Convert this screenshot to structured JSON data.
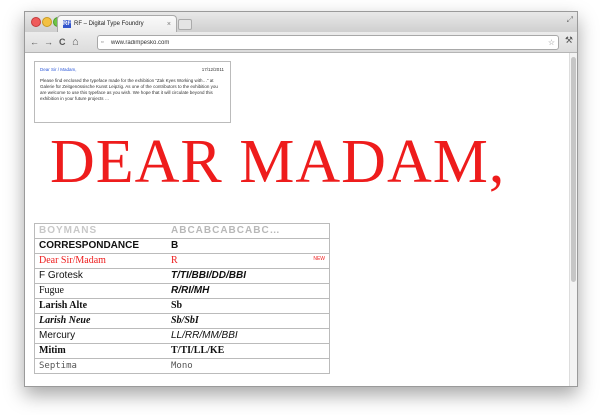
{
  "browser": {
    "tab_title": "RF – Digital Type Foundry",
    "tab_favicon": "RF",
    "url": "www.radimpesko.com",
    "close_glyph": "×",
    "back_glyph": "←",
    "forward_glyph": "→",
    "reload_glyph": "C",
    "home_glyph": "⌂",
    "star_glyph": "☆",
    "wrench_glyph": "⚒",
    "resize_glyph": "⤢"
  },
  "letter": {
    "greeting": "Dear Sir / Madam,",
    "date": "17/12/2011",
    "body": "Please find enclosed the typeface made for the exhibition “Zak Kyes Working with…” at Galerie für Zeitgenössische Kunst Leipzig. As one of the contributors to the exhibition you are welcome to use this typeface as you wish. We hope that it will circulate beyond this exhibition in your future projects …"
  },
  "headline": "DEAR MADAM,",
  "fonts": [
    {
      "name": "BOYMANS",
      "sample": "ABCABCABCABC…",
      "badge": ""
    },
    {
      "name": "CORRESPONDANCE",
      "sample": "B",
      "badge": ""
    },
    {
      "name": "Dear Sir/Madam",
      "sample": "R",
      "badge": "NEW"
    },
    {
      "name": "F Grotesk",
      "sample": "T/TI/BBI/DD/BBI",
      "badge": ""
    },
    {
      "name": "Fugue",
      "sample": "R/RI/MH",
      "badge": ""
    },
    {
      "name": "Larish Alte",
      "sample": "Sb",
      "badge": ""
    },
    {
      "name": "Larish Neue",
      "sample": "Sb/SbI",
      "badge": ""
    },
    {
      "name": "Mercury",
      "sample": "LL/RR/MM/BBI",
      "badge": ""
    },
    {
      "name": "Mitim",
      "sample": "T/TI/LL/KE",
      "badge": ""
    },
    {
      "name": "Septima",
      "sample": "Mono",
      "badge": ""
    }
  ],
  "colors": {
    "accent_red": "#ee1c1c",
    "link_blue": "#2b57d8"
  }
}
